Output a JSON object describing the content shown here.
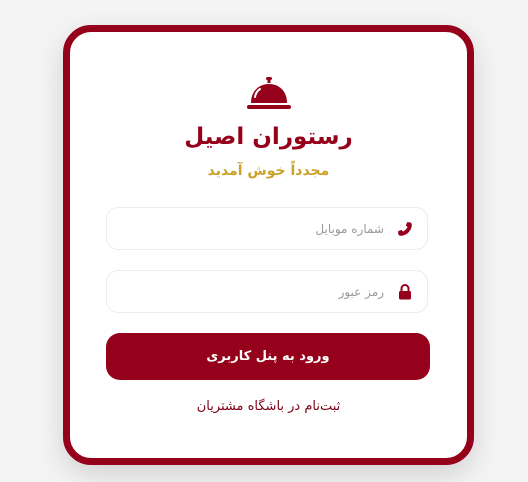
{
  "brand": {
    "logo_icon": "service-bell-icon",
    "title": "رستوران اصیل",
    "subtitle": "مجدداً خوش آمدید"
  },
  "form": {
    "phone": {
      "icon": "phone-icon",
      "placeholder": "شماره موبایل",
      "value": ""
    },
    "password": {
      "icon": "lock-icon",
      "placeholder": "رمز عبور",
      "value": ""
    },
    "submit_label": "ورود به پنل کاربری"
  },
  "register_link": "ثبت‌نام در باشگاه مشتریان",
  "colors": {
    "primary": "#95001a",
    "accent": "#c9a227",
    "background": "#f4f4f4",
    "card": "#ffffff"
  }
}
